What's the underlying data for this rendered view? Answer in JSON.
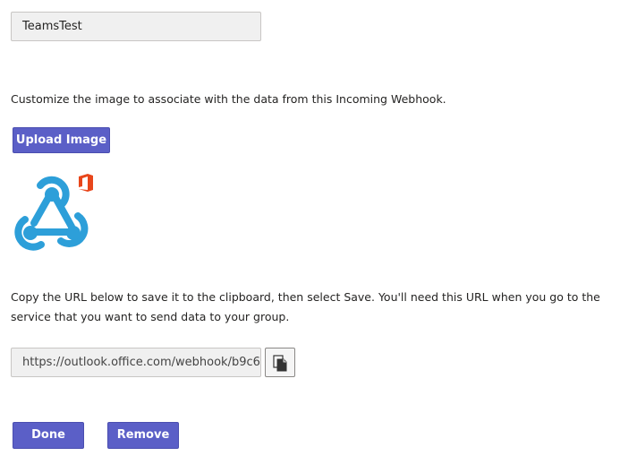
{
  "connector": {
    "name_value": "TeamsTest"
  },
  "image_section": {
    "description": "Customize the image to associate with the data from this Incoming Webhook.",
    "upload_label": "Upload Image",
    "logo_icon": "webhook-logo-icon",
    "badge_icon": "office-icon"
  },
  "url_section": {
    "description": "Copy the URL below to save it to the clipboard, then select Save. You'll need this URL when you go to the service that you want to send data to your group.",
    "url_value": "https://outlook.office.com/webhook/b9c6",
    "copy_icon": "copy-icon"
  },
  "actions": {
    "done_label": "Done",
    "remove_label": "Remove"
  },
  "colors": {
    "button": "#5b5fc7",
    "webhook_blue": "#2d9fd9",
    "office_red": "#e8461b"
  }
}
